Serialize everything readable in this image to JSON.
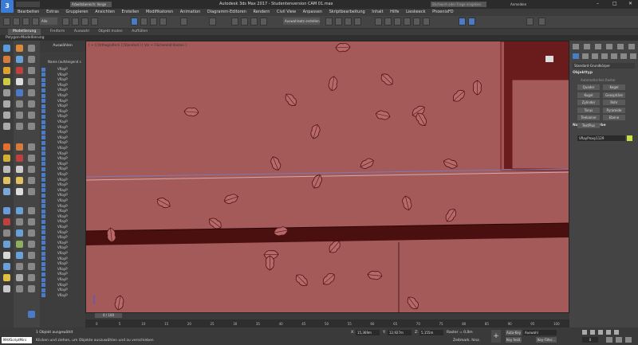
{
  "app": {
    "title": "Autodesk 3ds Max 2017 - Studentenversion CAM 01.max",
    "logo": "3",
    "workspace": "Arbeitsbereich: Vorge",
    "search_placeholder": "Stichwort oder Frage eingeben",
    "account": "Anmelden"
  },
  "menu": [
    "Bearbeiten",
    "Extras",
    "Gruppieren",
    "Ansichten",
    "Erstellen",
    "Modifikatoren",
    "Animation",
    "Diagramm-Editoren",
    "Rendern",
    "Civil View",
    "Anpassen",
    "Skriptbearbeitung",
    "Inhalt",
    "Hilfe",
    "Lieskeeck",
    "PhoenixFD"
  ],
  "toolbar": {
    "selection_filter": "Alle",
    "named_selection": "Auswahlsatz erstellen"
  },
  "ribbon": {
    "tabs": [
      "Modellierung",
      "Freiform",
      "Auswahl",
      "Objekt malen",
      "Auffüllen"
    ],
    "active_tab": "Modellierung",
    "sub": "Polygon-Modellierung"
  },
  "explorer": {
    "title": "Auswählen",
    "column": "Name (aufsteigend s",
    "rows": [
      "VRayP",
      "VRayP",
      "VRayP",
      "VRayP",
      "VRayP",
      "VRayP",
      "VRayP",
      "VRayP",
      "VRayP",
      "VRayP",
      "VRayP",
      "VRayP",
      "VRayP",
      "VRayP",
      "VRayP",
      "VRayP",
      "VRayP",
      "VRayP",
      "VRayP",
      "VRayP",
      "VRayP",
      "VRayP",
      "VRayP",
      "VRayP",
      "VRayP",
      "VRayP",
      "VRayP",
      "VRayP",
      "VRayP",
      "VRayP",
      "VRayP",
      "VRayP",
      "VRayP",
      "VRayP",
      "VRayP",
      "VRayP",
      "VRayP",
      "VRayP",
      "VRayP",
      "VRayP",
      "VRayP",
      "VRayP",
      "VRayP",
      "VRayP"
    ]
  },
  "viewport": {
    "label": "[ + ] [Orthografisch ] [Standard ] [ Vor + Flächenmit Kanten ]",
    "bg": "#a55a5a"
  },
  "right_panel": {
    "dropdown": "Standard-Grundkörper",
    "section_objtype": "Objekttyp",
    "autogrid": "Automatisches Raster",
    "buttons": [
      "Quader",
      "Kegel",
      "Kugel",
      "Geosphäre",
      "Zylinder",
      "Rohr",
      "Torus",
      "Pyramide",
      "Teekanne",
      "Ebene",
      "TextPlus"
    ],
    "section_name": "Name und Farbe",
    "object_name": "VRayProxy1129",
    "swatch": "#c8e040"
  },
  "timeline": {
    "frame": "0 / 100",
    "ticks": [
      "0",
      "5",
      "10",
      "15",
      "20",
      "25",
      "30",
      "35",
      "40",
      "45",
      "50",
      "55",
      "60",
      "65",
      "70",
      "75",
      "80",
      "85",
      "90",
      "95",
      "100"
    ]
  },
  "status": {
    "maxscript": "MAXScriptMini",
    "selected": "1 Objekt ausgewählt",
    "prompt": "Klicken und ziehen, um Objekte auszuwählen und zu verschieben",
    "x_label": "X:",
    "x": "15,369m",
    "y_label": "Y:",
    "y": "12,927m",
    "z_label": "Z:",
    "z": "5,155m",
    "grid": "Raster = 0,0m",
    "autokey": "Auto-Key",
    "setkey": "Key festl.",
    "selected_dd": "Auswahl",
    "keyfilter": "Key-Filter...",
    "time_tag": "Zeitmark. hinz.",
    "frame_field": "0"
  }
}
